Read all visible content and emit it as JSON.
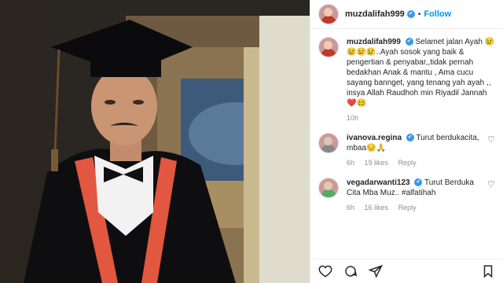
{
  "post": {
    "username": "muzdalifah999",
    "follow_label": "Follow",
    "separator": "•"
  },
  "caption": {
    "username": "muzdalifah999",
    "text": "Selamet jalan Ayah 😢😢😢😢..Ayah sosok yang baik & pengertian & penyabar,,tidak pernah bedakhan Anak & mantu , Ama cucu sayang bannget, yang tenang yah ayah ,, insya Allah Raudhoh min Riyadil Jannah ❤️🥴",
    "time": "10h"
  },
  "comments": [
    {
      "username": "ivanova.regina",
      "text": "Turut berdukacita, mbaa😔🙏",
      "time": "6h",
      "likes": "19 likes",
      "reply": "Reply"
    },
    {
      "username": "vegadarwanti123",
      "text": "Turut Berduka Cita Mba Muz.. #alfatihah",
      "time": "6h",
      "likes": "16 likes",
      "reply": "Reply"
    }
  ],
  "icons": {
    "verified": "verified-icon",
    "heart": "heart-icon",
    "comment": "comment-icon",
    "share": "share-icon",
    "save": "bookmark-icon"
  },
  "colors": {
    "accent": "#0095f6",
    "verified": "#3897f0"
  }
}
